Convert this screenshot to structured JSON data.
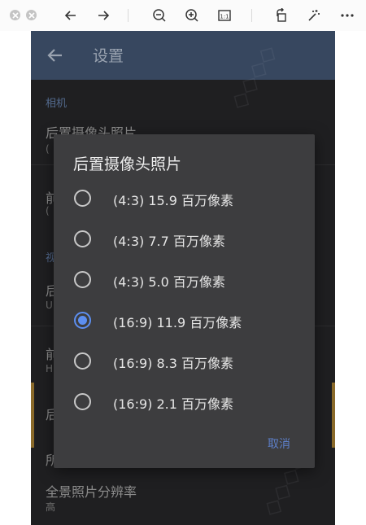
{
  "viewer": {
    "icons": [
      "close-dot-icon",
      "minimize-dot-icon",
      "back-arrow-icon",
      "forward-arrow-icon",
      "zoom-out-icon",
      "zoom-in-icon",
      "actual-size-icon",
      "rotate-icon",
      "magic-wand-icon",
      "more-icon"
    ],
    "actual_size_label": "1:1"
  },
  "app_bar": {
    "title": "设置"
  },
  "settings": {
    "section_camera": "相机",
    "rear_photo_title": "后置摄像头照片",
    "rear_photo_sub": "(",
    "front_photo_title": "前",
    "front_photo_sub": "(",
    "section_video": "视",
    "rear_video_title": "后",
    "rear_video_sub": "U",
    "front_video_title": "前",
    "front_video_sub": "H",
    "item_rear3": "后",
    "item_panorama_prefix": "所",
    "panorama_title": "全景照片分辨率",
    "panorama_sub": "高"
  },
  "dialog": {
    "title": "后置摄像头照片",
    "options": [
      {
        "label": "(4:3) 15.9 百万像素",
        "checked": false
      },
      {
        "label": "(4:3) 7.7 百万像素",
        "checked": false
      },
      {
        "label": "(4:3) 5.0 百万像素",
        "checked": false
      },
      {
        "label": "(16:9) 11.9 百万像素",
        "checked": true
      },
      {
        "label": "(16:9) 8.3 百万像素",
        "checked": false
      },
      {
        "label": "(16:9) 2.1 百万像素",
        "checked": false
      }
    ],
    "cancel_label": "取消"
  },
  "colors": {
    "accent": "#5d8ff0",
    "app_bar": "#37475f",
    "dialog_bg": "#3d3d3f",
    "screen_bg": "#1f1f21"
  }
}
